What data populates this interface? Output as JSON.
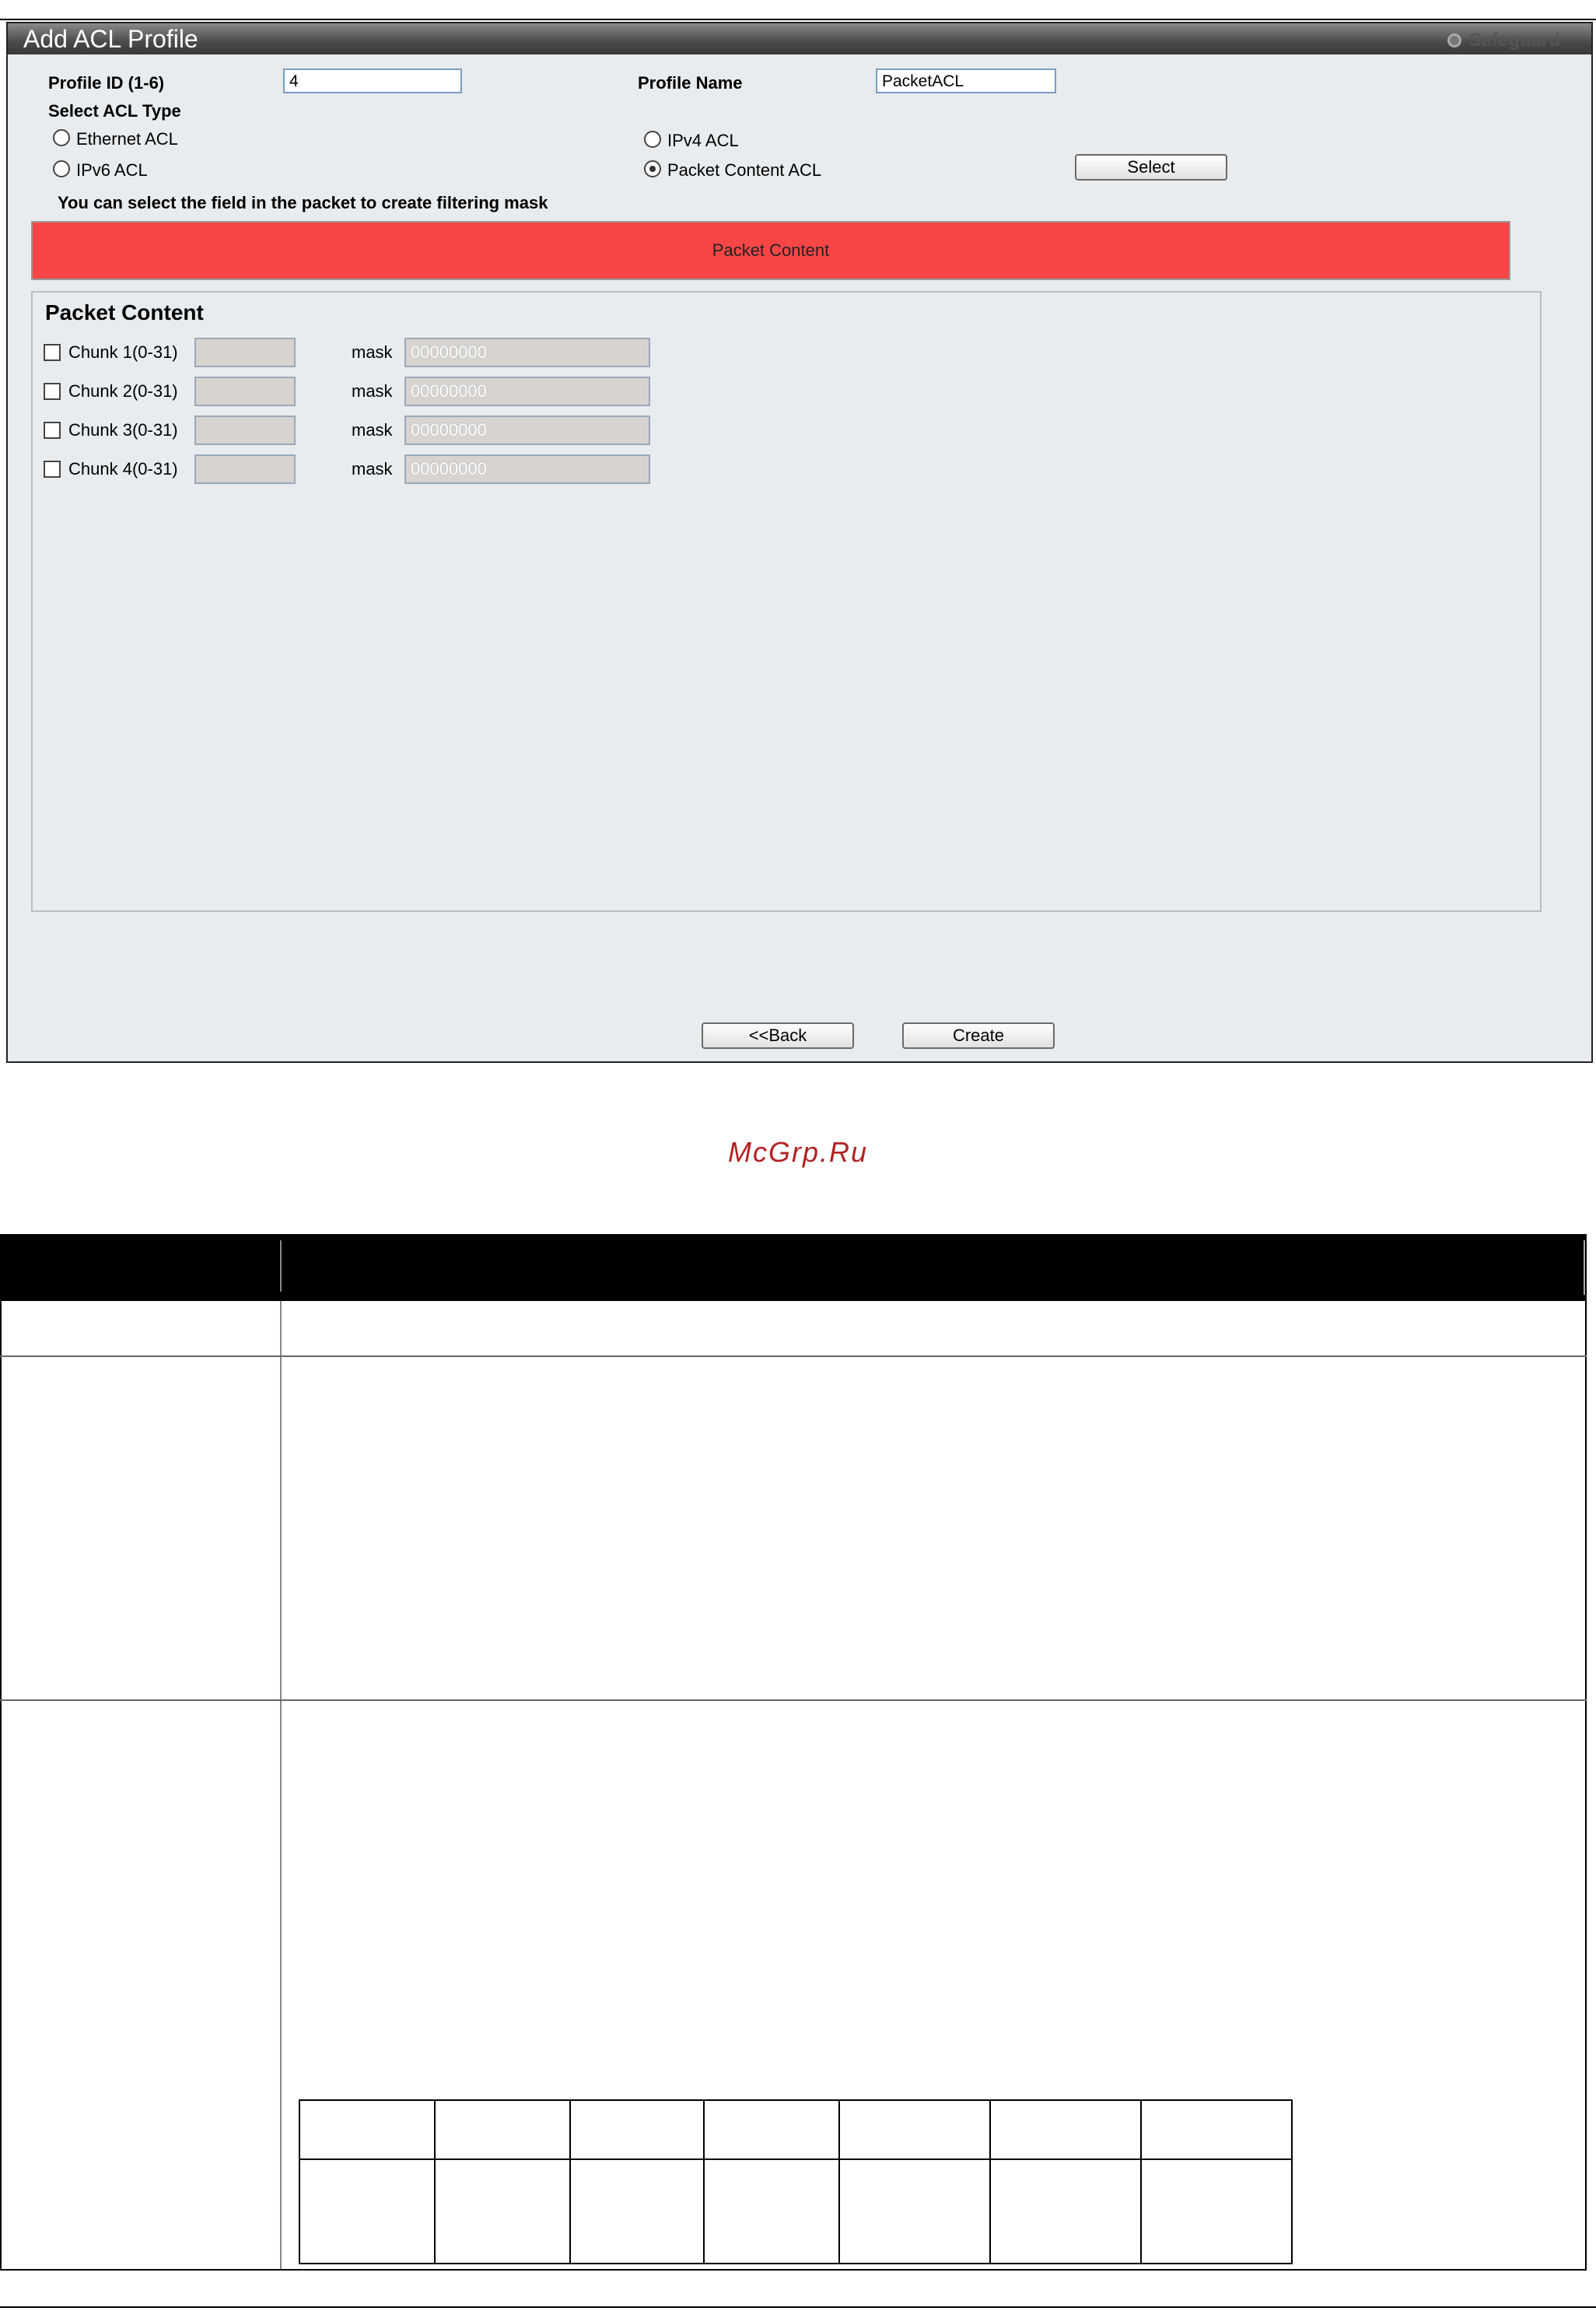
{
  "window": {
    "title": "Add ACL Profile",
    "safeguard_label": "Safeguard"
  },
  "form": {
    "profile_id_label": "Profile ID (1-6)",
    "profile_id_value": "4",
    "profile_name_label": "Profile Name",
    "profile_name_value": "PacketACL",
    "select_acl_type_label": "Select ACL Type",
    "acl_types": [
      {
        "label": "Ethernet ACL",
        "selected": false
      },
      {
        "label": "IPv4 ACL",
        "selected": false
      },
      {
        "label": "IPv6 ACL",
        "selected": false
      },
      {
        "label": "Packet Content ACL",
        "selected": true
      }
    ],
    "select_button": "Select",
    "hint": "You can select the field in the packet to create filtering mask"
  },
  "packet_bar": {
    "label": "Packet Content"
  },
  "packet_content": {
    "title": "Packet Content",
    "chunks": [
      {
        "label": "Chunk 1(0-31)",
        "value": "",
        "mask_label": "mask",
        "mask_value": "00000000"
      },
      {
        "label": "Chunk 2(0-31)",
        "value": "",
        "mask_label": "mask",
        "mask_value": "00000000"
      },
      {
        "label": "Chunk 3(0-31)",
        "value": "",
        "mask_label": "mask",
        "mask_value": "00000000"
      },
      {
        "label": "Chunk 4(0-31)",
        "value": "",
        "mask_label": "mask",
        "mask_value": "00000000"
      }
    ]
  },
  "buttons": {
    "back": "<<Back",
    "create": "Create"
  },
  "watermark": "McGrp.Ru"
}
